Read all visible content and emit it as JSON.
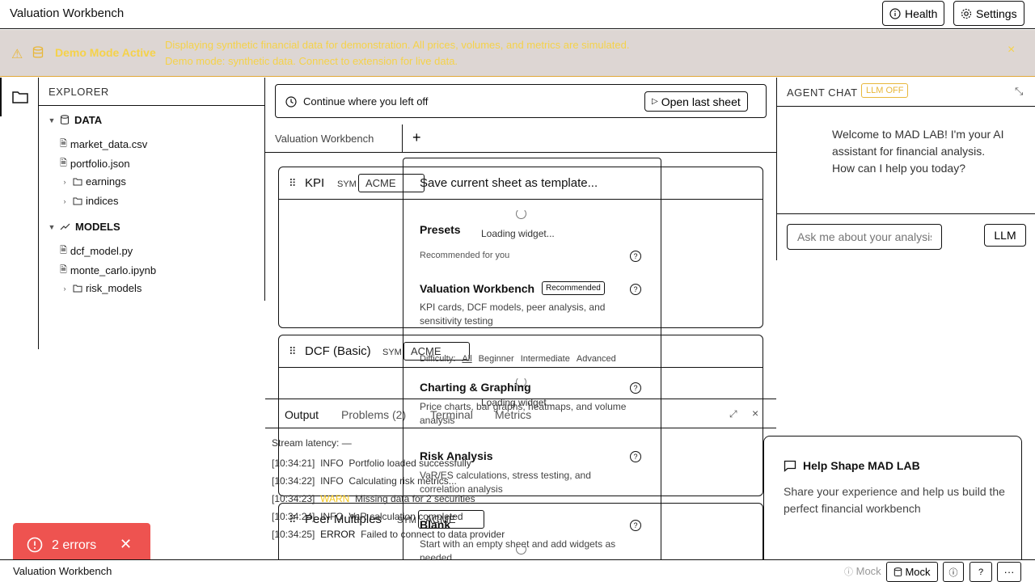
{
  "app": {
    "title": "Valuation Workbench",
    "health_label": "Health",
    "settings_label": "Settings"
  },
  "banner": {
    "title": "Demo Mode Active",
    "line1": "Displaying synthetic financial data for demonstration. All prices, volumes, and metrics are simulated.",
    "line2": "Demo mode: synthetic data. Connect to extension for live data.",
    "close": "×",
    "color": "#f5d24a"
  },
  "explorer": {
    "title": "EXPLORER",
    "sections": [
      {
        "label": "DATA",
        "icon": "database-icon"
      },
      {
        "label": "MODELS",
        "icon": "trending-icon"
      }
    ],
    "data_items": [
      "market_data.csv",
      "portfolio.json",
      "earnings",
      "indices"
    ],
    "model_items": [
      "dcf_model.py",
      "monte_carlo.ipynb",
      "risk_models"
    ]
  },
  "continue": {
    "text": "Continue where you left off",
    "button": "Open last sheet"
  },
  "tabs": {
    "sheet": "Valuation Workbench",
    "add": "+"
  },
  "widgets": [
    {
      "title": "KPI",
      "sym_label": "SYM",
      "sym_value": "ACME"
    },
    {
      "title": "DCF (Basic)",
      "sym_label": "SYM",
      "sym_value": "ACME"
    },
    {
      "title": "Peer Multiples",
      "sym_label": "SYM",
      "sym_value": "ACME"
    }
  ],
  "loading": "Loading widget...",
  "template_menu": {
    "save": "Save current sheet as template...",
    "presets": "Presets",
    "recommended_header": "Recommended for you",
    "difficulty_label": "Difficulty:",
    "difficulty_options": [
      "All",
      "Beginner",
      "Intermediate",
      "Advanced"
    ],
    "items": [
      {
        "name": "Valuation Workbench",
        "badge": "Recommended",
        "desc": "KPI cards, DCF models, peer analysis, and sensitivity testing"
      },
      {
        "name": "Charting & Graphing",
        "desc": "Price charts, bar graphs, heatmaps, and volume analysis"
      },
      {
        "name": "Risk Analysis",
        "desc": "VaR/ES calculations, stress testing, and correlation analysis"
      },
      {
        "name": "Blank",
        "desc": "Start with an empty sheet and add widgets as needed"
      }
    ]
  },
  "output": {
    "tabs": [
      "Output",
      "Problems (2)",
      "Terminal",
      "Metrics"
    ],
    "stream": "Stream latency: —",
    "logs": [
      {
        "time": "[10:34:21]",
        "level": "INFO",
        "msg": "Portfolio loaded successfully"
      },
      {
        "time": "[10:34:22]",
        "level": "INFO",
        "msg": "Calculating risk metrics..."
      },
      {
        "time": "[10:34:23]",
        "level": "WARN",
        "msg": "Missing data for 2 securities"
      },
      {
        "time": "[10:34:24]",
        "level": "INFO",
        "msg": "VaR calculation completed"
      },
      {
        "time": "[10:34:25]",
        "level": "ERROR",
        "msg": "Failed to connect to data provider"
      }
    ]
  },
  "agent": {
    "title": "AGENT CHAT",
    "badge": "LLM OFF",
    "message": "Welcome to MAD LAB! I'm your AI assistant for financial analysis. How can I help you today?",
    "input_placeholder": "Ask me about your analysis...",
    "llm_button": "LLM"
  },
  "help_card": {
    "title": "Help Shape MAD LAB",
    "text": "Share your experience and help us build the perfect financial workbench"
  },
  "toast": {
    "text": "2 errors",
    "color": "#ee5350"
  },
  "status": {
    "left": "Valuation Workbench",
    "mock_faded": "Mock",
    "mock_button": "Mock",
    "more": "···"
  }
}
